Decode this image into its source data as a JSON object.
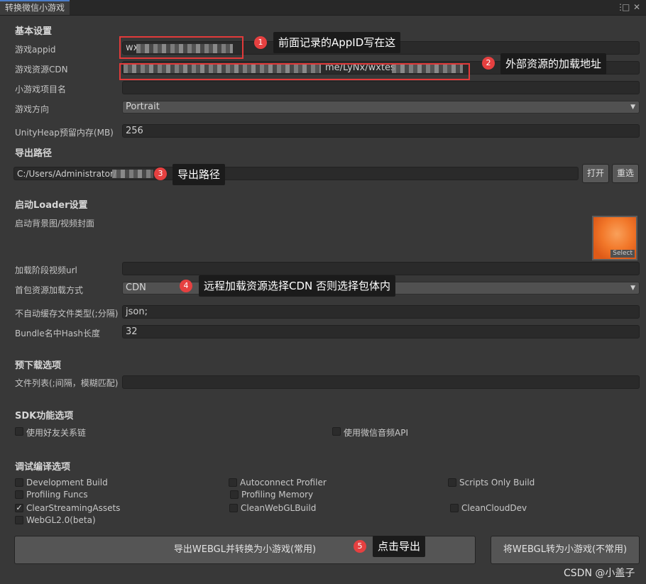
{
  "window": {
    "tab_title": "转换微信小游戏",
    "menu_glyph": "⋮",
    "maximize_glyph": "□",
    "close_glyph": "✕"
  },
  "basic": {
    "section_title": "基本设置",
    "appid_label": "游戏appid",
    "appid_value": "wx",
    "cdn_label": "游戏资源CDN",
    "cdn_value": "me/LyNx/wxtes",
    "project_name_label": "小游戏项目名",
    "project_name_value": "",
    "orientation_label": "游戏方向",
    "orientation_value": "Portrait",
    "heap_label": "UnityHeap预留内存(MB)",
    "heap_value": "256"
  },
  "export_path": {
    "section_title": "导出路径",
    "path_value": "C:/Users/Administrator/",
    "open_button": "打开",
    "reselect_button": "重选"
  },
  "loader": {
    "section_title": "启动Loader设置",
    "bg_label": "启动背景图/视频封面",
    "select_label": "Select",
    "video_url_label": "加载阶段视频url",
    "video_url_value": "",
    "first_pkg_label": "首包资源加载方式",
    "first_pkg_value": "CDN",
    "no_cache_label": "不自动缓存文件类型(;分隔)",
    "no_cache_value": "json;",
    "hash_len_label": "Bundle名中Hash长度",
    "hash_len_value": "32"
  },
  "preload": {
    "section_title": "预下载选项",
    "file_list_label": "文件列表(;间隔，模糊匹配)",
    "file_list_value": ""
  },
  "sdk": {
    "section_title": "SDK功能选项",
    "friend_chain_label": "使用好友关系链",
    "wx_audio_label": "使用微信音频API"
  },
  "debug": {
    "section_title": "调试编译选项",
    "options": [
      {
        "label": "Development Build",
        "checked": false
      },
      {
        "label": "Autoconnect Profiler",
        "checked": false
      },
      {
        "label": "Scripts Only Build",
        "checked": false
      },
      {
        "label": "Profiling Funcs",
        "checked": false
      },
      {
        "label": "Profiling Memory",
        "checked": false
      },
      {
        "label": "ClearStreamingAssets",
        "checked": true
      },
      {
        "label": "CleanWebGLBuild",
        "checked": false
      },
      {
        "label": "CleanCloudDev",
        "checked": false
      },
      {
        "label": "WebGL2.0(beta)",
        "checked": false
      }
    ],
    "check_glyph": "✓"
  },
  "actions": {
    "export_convert_button": "导出WEBGL并转换为小游戏(常用)",
    "convert_only_button": "将WEBGL转为小游戏(不常用)"
  },
  "annotations": [
    {
      "num": "1",
      "text": "前面记录的AppID写在这"
    },
    {
      "num": "2",
      "text": "外部资源的加载地址"
    },
    {
      "num": "3",
      "text": "导出路径"
    },
    {
      "num": "4",
      "text": "远程加载资源选择CDN 否则选择包体内"
    },
    {
      "num": "5",
      "text": "点击导出"
    }
  ],
  "watermark": "CSDN @小盖子",
  "colors": {
    "badge": "#e64040",
    "highlight_box": "#e33a3a",
    "callout_bg": "#1b1b1b",
    "tab_accent": "#4a7cc8"
  }
}
